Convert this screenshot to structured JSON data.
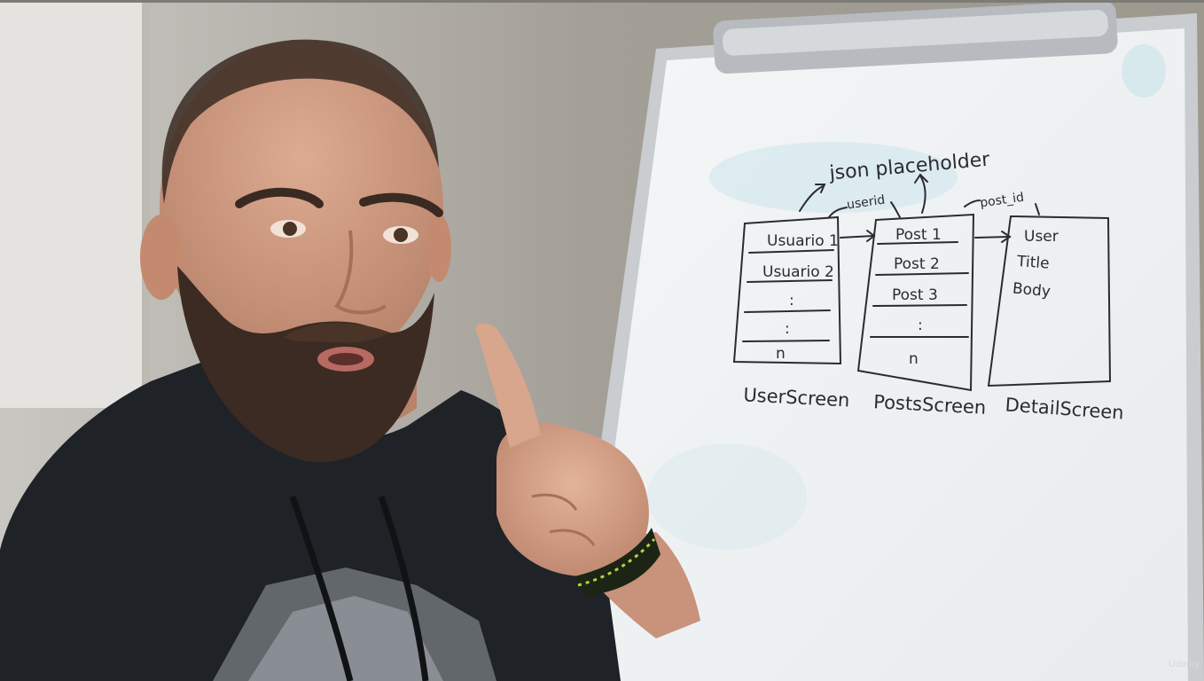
{
  "whiteboard": {
    "title": "json placeholder",
    "annotations": {
      "userid": "userid",
      "post_id": "post_id"
    },
    "screens": [
      {
        "label": "UserScreen",
        "items": [
          "Usuario 1",
          "Usuario 2",
          ":",
          ":",
          "n"
        ]
      },
      {
        "label": "PostsScreen",
        "items": [
          "Post 1",
          "Post 2",
          "Post 3",
          ":",
          "n"
        ]
      },
      {
        "label": "DetailScreen",
        "items": [
          "User",
          "Title",
          "Body"
        ]
      }
    ]
  },
  "watermark": "Udemy",
  "colors": {
    "ink": "#2b2b33",
    "board": "#f1f3f4",
    "wall": "#a7a39b",
    "hoodie": "#1f2226",
    "skin": "#d9a98f"
  }
}
